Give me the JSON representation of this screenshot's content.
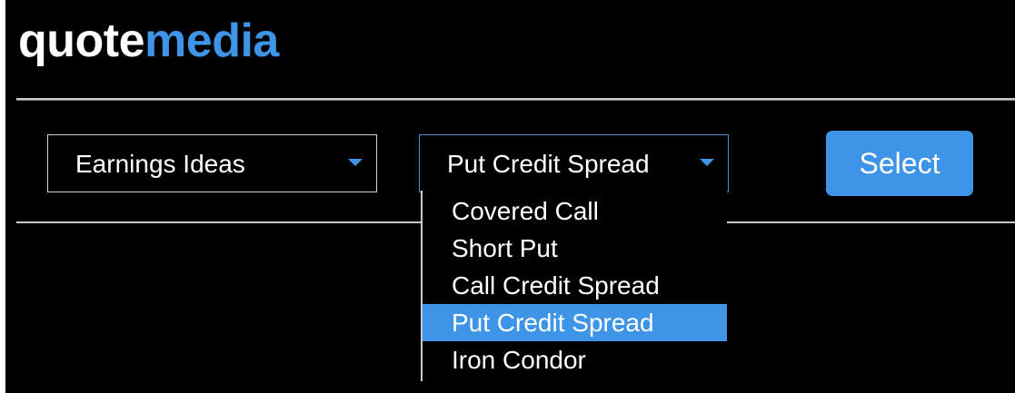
{
  "logo": {
    "part1": "quote",
    "part2": "media"
  },
  "filters": {
    "category": {
      "value": "Earnings Ideas"
    },
    "strategy": {
      "value": "Put Credit Spread",
      "options": [
        "Covered Call",
        "Short Put",
        "Call Credit Spread",
        "Put Credit Spread",
        "Iron Condor"
      ],
      "highlighted_option": "Put Credit Spread"
    }
  },
  "select_button": {
    "label": "Select"
  },
  "colors": {
    "accent": "#3e95e8",
    "background": "#000000",
    "text": "#ffffff"
  }
}
